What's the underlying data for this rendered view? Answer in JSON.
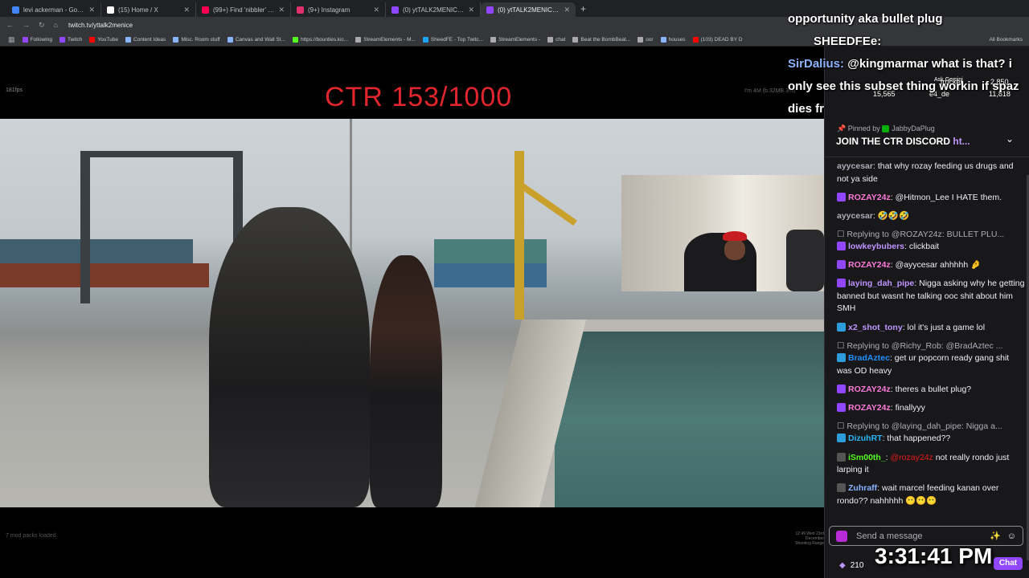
{
  "browser": {
    "tabs": [
      {
        "title": "levi ackerman - Google Search",
        "color": "#4285f4"
      },
      {
        "title": "(15) Home / X",
        "color": "#ffffff"
      },
      {
        "title": "(99+) Find 'nibbler' on TikTok | T",
        "color": "#ff0050"
      },
      {
        "title": "(9+) Instagram",
        "color": "#e1306c"
      },
      {
        "title": "(0) ytTALK2MENICE - Twitch",
        "color": "#9147ff"
      },
      {
        "title": "(0) ytTALK2MENICE - Twitch",
        "color": "#9147ff",
        "active": true
      }
    ],
    "url": "twitch.tv/yttalk2menice",
    "bookmarks": [
      {
        "label": "Following",
        "color": "#9147ff"
      },
      {
        "label": "Twitch",
        "color": "#9147ff"
      },
      {
        "label": "YouTube",
        "color": "#ff0000"
      },
      {
        "label": "Content Ideas",
        "color": "#8ab4f8"
      },
      {
        "label": "Misc. Room stuff",
        "color": "#8ab4f8"
      },
      {
        "label": "Canvas and Wall St...",
        "color": "#8ab4f8"
      },
      {
        "label": "https://bounties.kic...",
        "color": "#53fc18"
      },
      {
        "label": "StreamElements - M...",
        "color": "#aaaaaa"
      },
      {
        "label": "SheedFE - Top Twitc...",
        "color": "#1da1f2"
      },
      {
        "label": "StreamElements -",
        "color": "#aaaaaa"
      },
      {
        "label": "chat",
        "color": "#aaaaaa"
      },
      {
        "label": "Beat the BombBeat...",
        "color": "#aaaaaa"
      },
      {
        "label": "oor",
        "color": "#aaaaaa"
      },
      {
        "label": "houses",
        "color": "#8ab4f8"
      },
      {
        "label": "(103) DEAD BY D",
        "color": "#ff0000"
      }
    ],
    "all_bookmarks": "All Bookmarks"
  },
  "stream": {
    "fps": "181fps",
    "title_overlay": "CTR 153/1000",
    "mod_text": "7 mod packs loaded",
    "right_text": "12:49 Wed 23rd December Shooting Range",
    "top_right": "I'm 4M (b:32MB 3%)"
  },
  "overlay_chat": {
    "line1": "opportunity aka bullet plug",
    "user2": "SHEEDFEe:",
    "user3": "SirDalius:",
    "msg3": "@kingmarmar what is that? i only see this subset thing workin if spaz dies fr"
  },
  "stats": {
    "viewers_a": "15,565",
    "viewers_b": "2,850",
    "viewers_c": "11,818",
    "name_a": "trucker",
    "name_b": "e4_de",
    "ask": "Ask Gemini"
  },
  "pinned": {
    "by_prefix": "Pinned by",
    "by_user": "JabbyDaPlug",
    "message": "JOIN THE CTR DISCORD",
    "link": "ht..."
  },
  "chat": [
    {
      "user": "ayycesar",
      "color": "#adadb8",
      "text": "that why rozay feeding us drugs and not ya side",
      "badge": ""
    },
    {
      "user": "ROZAY24z",
      "color": "#ff7ad9",
      "text": "@Hitmon_Lee I HATE them.",
      "badge": "#9147ff"
    },
    {
      "user": "ayycesar",
      "color": "#adadb8",
      "text": "🤣🤣🤣",
      "badge": ""
    },
    {
      "reply": "Replying to @ROZAY24z: BULLET PLU...",
      "user": "lowkeybubers",
      "color": "#bf94ff",
      "text": "clickbait",
      "badge": "#9147ff"
    },
    {
      "user": "ROZAY24z",
      "color": "#ff7ad9",
      "text": "@ayycesar ahhhhh 🤌",
      "badge": "#9147ff"
    },
    {
      "user": "laying_dah_pipe",
      "color": "#bf94ff",
      "text": "Nigga asking why he getting banned but wasnt he talking ooc shit about him SMH",
      "badge": "#9147ff"
    },
    {
      "user": "x2_shot_tony",
      "color": "#bf94ff",
      "text": "lol it's just a game lol",
      "badge": "#2d9cdb"
    },
    {
      "reply": "Replying to @Richy_Rob: @BradAztec ...",
      "user": "BradAztec",
      "color": "#1e90ff",
      "text": "get ur popcorn ready gang shit was OD heavy",
      "badge": "#2d9cdb"
    },
    {
      "user": "ROZAY24z",
      "color": "#ff7ad9",
      "text": "theres a bullet plug?",
      "badge": "#9147ff"
    },
    {
      "user": "ROZAY24z",
      "color": "#ff7ad9",
      "text": "finallyyy",
      "badge": "#9147ff"
    },
    {
      "reply": "Replying to @laying_dah_pipe: Nigga a...",
      "user": "DizuhRT",
      "color": "#29b6f6",
      "text": "that happened??",
      "badge": "#2d9cdb"
    },
    {
      "user": "iSm00th_",
      "color": "#53fc18",
      "text": "@rozay24z not really rondo just larping it",
      "badge": "#555555",
      "mention": "@rozay24z"
    },
    {
      "user": "Zuhraff",
      "color": "#8ab4ff",
      "text": "wait marcel feeding kanan over rondo?? nahhhhh 😶😶😶",
      "badge": "#555555"
    }
  ],
  "input": {
    "placeholder": "Send a message",
    "points": "210",
    "chat_button": "Chat"
  },
  "clock": "3:31:41 PM"
}
